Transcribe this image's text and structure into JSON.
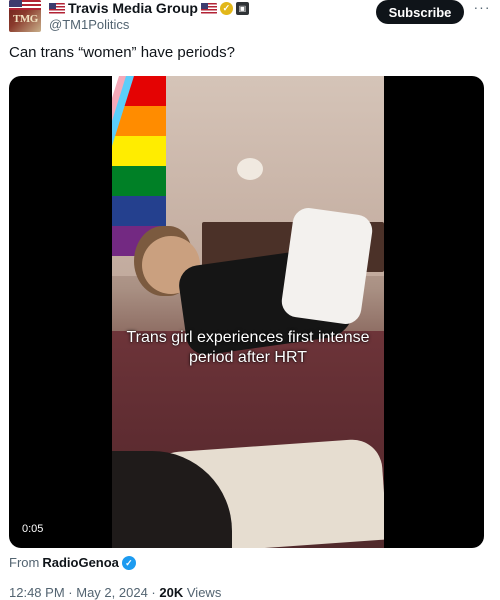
{
  "author": {
    "display_name": "Travis Media Group",
    "handle": "@TM1Politics",
    "avatar_text": "TMG"
  },
  "subscribe_label": "Subscribe",
  "more_label": "···",
  "post_text": "Can trans “women” have periods?",
  "video": {
    "caption": "Trans girl experiences first intense period after HRT",
    "timestamp": "0:05"
  },
  "from": {
    "prefix": "From",
    "source": "RadioGenoa"
  },
  "meta": {
    "time": "12:48 PM",
    "sep1": "·",
    "date": "May 2, 2024",
    "sep2": "·",
    "views_count": "20K",
    "views_label": "Views"
  },
  "icons": {
    "flag": "us-flag-emoji",
    "gold_check": "gold-verified-badge",
    "affiliate": "affiliate-badge",
    "blue_check": "blue-verified-badge"
  },
  "colors": {
    "text": "#0f1419",
    "muted": "#536471",
    "verified_blue": "#1d9bf0",
    "gold": "#e2b719"
  }
}
